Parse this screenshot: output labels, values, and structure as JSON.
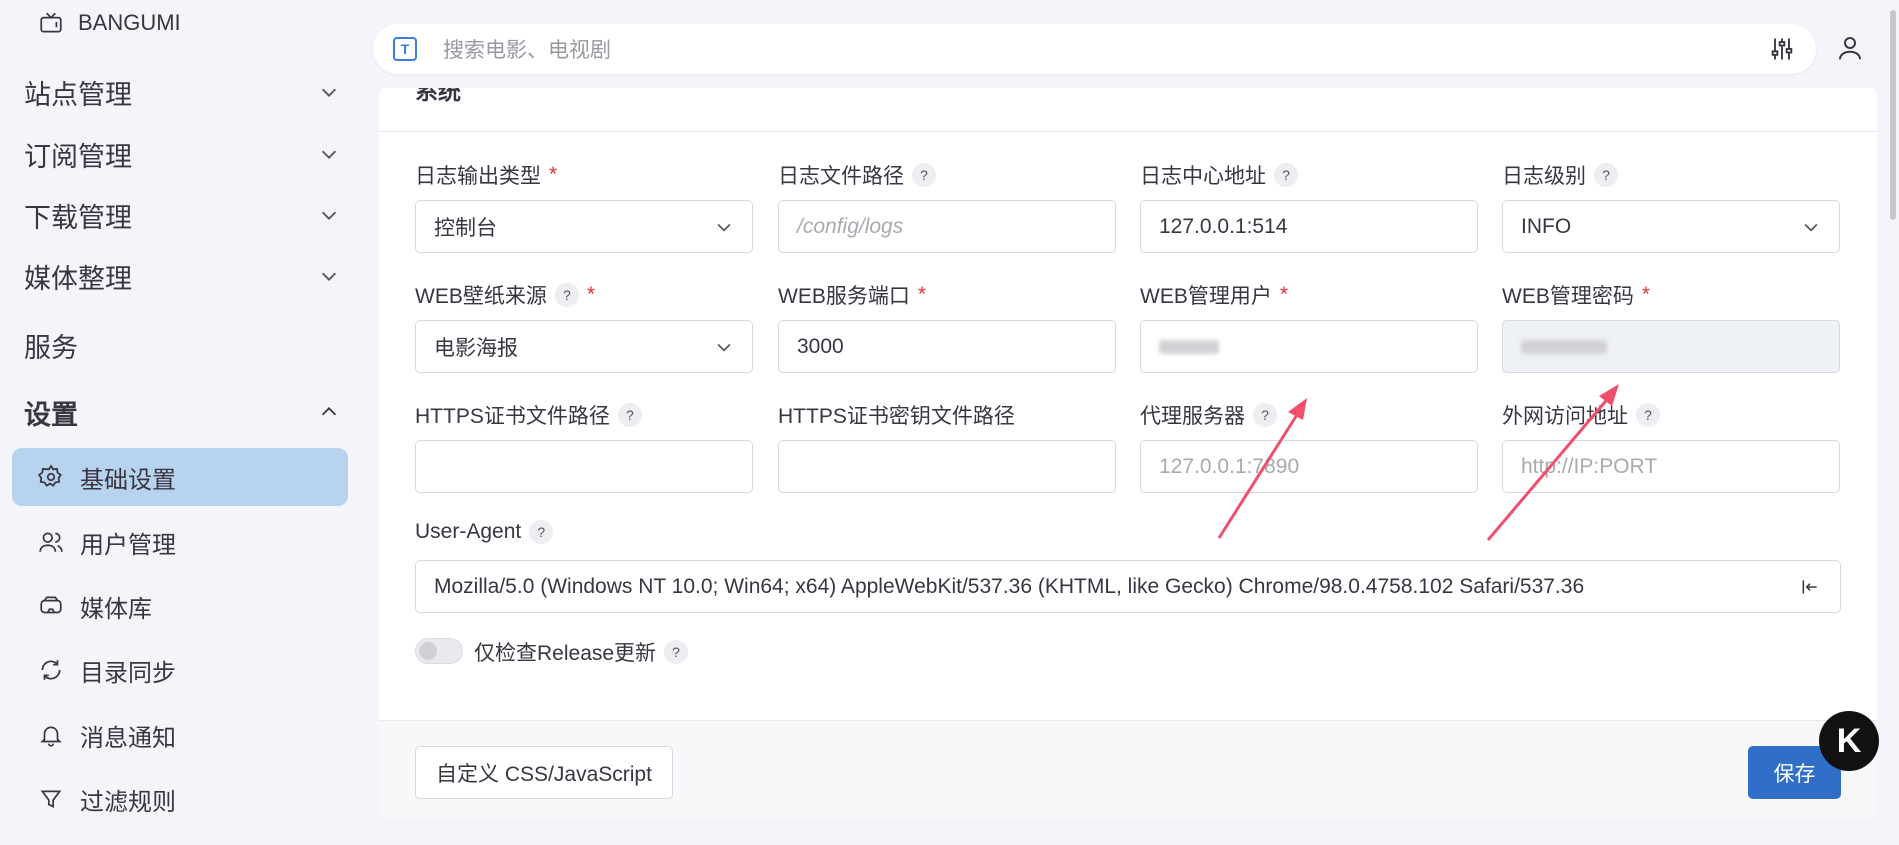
{
  "app": {
    "brand": "BANGUMI"
  },
  "sidebar": {
    "groups": [
      {
        "label": "站点管理"
      },
      {
        "label": "订阅管理"
      },
      {
        "label": "下载管理"
      },
      {
        "label": "媒体整理"
      },
      {
        "label": "服务"
      },
      {
        "label": "设置"
      }
    ],
    "items": [
      {
        "label": "基础设置"
      },
      {
        "label": "用户管理"
      },
      {
        "label": "媒体库"
      },
      {
        "label": "目录同步"
      },
      {
        "label": "消息通知"
      },
      {
        "label": "过滤规则"
      }
    ]
  },
  "search": {
    "placeholder": "搜索电影、电视剧"
  },
  "card": {
    "title": "系统"
  },
  "fields": {
    "log_type": {
      "label": "日志输出类型",
      "value": "控制台"
    },
    "log_path": {
      "label": "日志文件路径",
      "placeholder": "/config/logs"
    },
    "log_center": {
      "label": "日志中心地址",
      "value": "127.0.0.1:514"
    },
    "log_level": {
      "label": "日志级别",
      "value": "INFO"
    },
    "wallpaper": {
      "label": "WEB壁纸来源",
      "value": "电影海报"
    },
    "web_port": {
      "label": "WEB服务端口",
      "value": "3000"
    },
    "web_user": {
      "label": "WEB管理用户"
    },
    "web_pass": {
      "label": "WEB管理密码"
    },
    "https_cert": {
      "label": "HTTPS证书文件路径"
    },
    "https_key": {
      "label": "HTTPS证书密钥文件路径"
    },
    "proxy": {
      "label": "代理服务器",
      "placeholder": "127.0.0.1:7890"
    },
    "public_url": {
      "label": "外网访问地址",
      "placeholder": "http://IP:PORT"
    },
    "user_agent": {
      "label": "User-Agent",
      "value": "Mozilla/5.0 (Windows NT 10.0; Win64; x64) AppleWebKit/537.36 (KHTML, like Gecko) Chrome/98.0.4758.102 Safari/537.36"
    },
    "release_only": {
      "label": "仅检查Release更新"
    }
  },
  "help_mark": "?",
  "required_mark": "*",
  "buttons": {
    "custom_css": "自定义 CSS/JavaScript",
    "save": "保存"
  },
  "badge": "K",
  "search_icon_letter": "T",
  "colors": {
    "accent": "#2f6fc8",
    "active_nav": "#b7d3ee",
    "required": "#e0363c",
    "arrow": "#f0506e"
  }
}
